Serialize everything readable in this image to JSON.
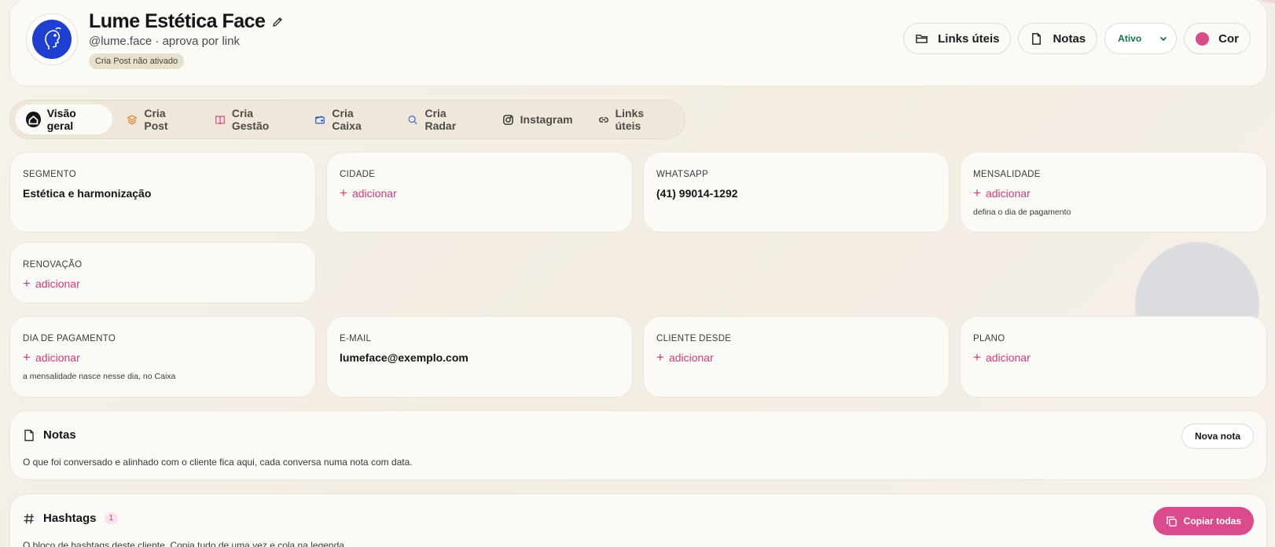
{
  "header": {
    "title": "Lume Estética Face",
    "subtitle": "@lume.face · aprova por link",
    "badge": "Cria Post não ativado",
    "actions": {
      "links": "Links úteis",
      "notes": "Notas",
      "status": "Ativo",
      "color": "Cor"
    },
    "accent_color": "#d94b8c"
  },
  "tabs": [
    {
      "label": "Visão geral",
      "icon": "home-icon",
      "active": true
    },
    {
      "label": "Cria Post",
      "icon": "layers-icon"
    },
    {
      "label": "Cria Gestão",
      "icon": "book-icon"
    },
    {
      "label": "Cria Caixa",
      "icon": "wallet-icon"
    },
    {
      "label": "Cria Radar",
      "icon": "search-icon"
    },
    {
      "label": "Instagram",
      "icon": "instagram-icon"
    },
    {
      "label": "Links úteis",
      "icon": "link-icon"
    }
  ],
  "fields": {
    "segmento": {
      "label": "SEGMENTO",
      "value": "Estética e harmonização"
    },
    "cidade": {
      "label": "CIDADE",
      "add": "adicionar"
    },
    "whatsapp": {
      "label": "WHATSAPP",
      "value": "(41) 99014-1292"
    },
    "mensalidade": {
      "label": "MENSALIDADE",
      "add": "adicionar",
      "hint": "defina o dia de pagamento"
    },
    "renovacao": {
      "label": "RENOVAÇÃO",
      "add": "adicionar"
    },
    "dia_pagamento": {
      "label": "DIA DE PAGAMENTO",
      "add": "adicionar",
      "hint": "a mensalidade nasce nesse dia, no Caixa"
    },
    "email": {
      "label": "E-MAIL",
      "value": "lumeface@exemplo.com"
    },
    "cliente_desde": {
      "label": "CLIENTE DESDE",
      "add": "adicionar"
    },
    "plano": {
      "label": "PLANO",
      "add": "adicionar"
    }
  },
  "notes": {
    "title": "Notas",
    "description": "O que foi conversado e alinhado com o cliente fica aqui, cada conversa numa nota com data.",
    "button": "Nova nota"
  },
  "hashtags": {
    "title": "Hashtags",
    "count": "1",
    "description": "O bloco de hashtags deste cliente. Copia tudo de uma vez e cola na legenda.",
    "button": "Copiar todas"
  }
}
